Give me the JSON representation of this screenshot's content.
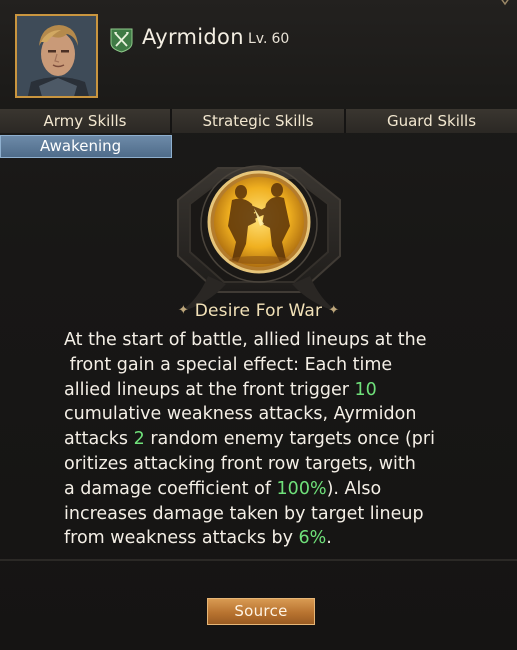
{
  "hero": {
    "name": "Ayrmidon",
    "level_prefix": "Lv.",
    "level": "60",
    "portrait": "hero-portrait",
    "class_icon": "crossed-swords-shield-icon"
  },
  "tabs": [
    {
      "label": "Army Skills"
    },
    {
      "label": "Strategic Skills"
    },
    {
      "label": "Guard Skills"
    }
  ],
  "subtab": {
    "label": "Awakening",
    "active": true
  },
  "skill": {
    "icon": "dueling-warriors-emblem",
    "name": "Desire For War",
    "desc": {
      "p1": "At the start of battle, allied lineups at the\n front gain a special effect: Each time\nallied lineups at the front trigger ",
      "v1": "10",
      "p2": "\ncumulative weakness attacks, Ayrmidon\nattacks ",
      "v2": "2",
      "p3": " random enemy targets once (pri\noritizes attacking front row targets, with\na damage coefficient of ",
      "v3": "100%",
      "p4": "). Also\nincreases damage taken by target lineup\nfrom weakness attacks by ",
      "v4": "6%",
      "p5": "."
    }
  },
  "source_button": {
    "label": "Source"
  },
  "colors": {
    "highlight": "#6fe07a",
    "accent_gold": "#c9953f",
    "tab_active": "#5b7896",
    "button": "#b87330"
  }
}
